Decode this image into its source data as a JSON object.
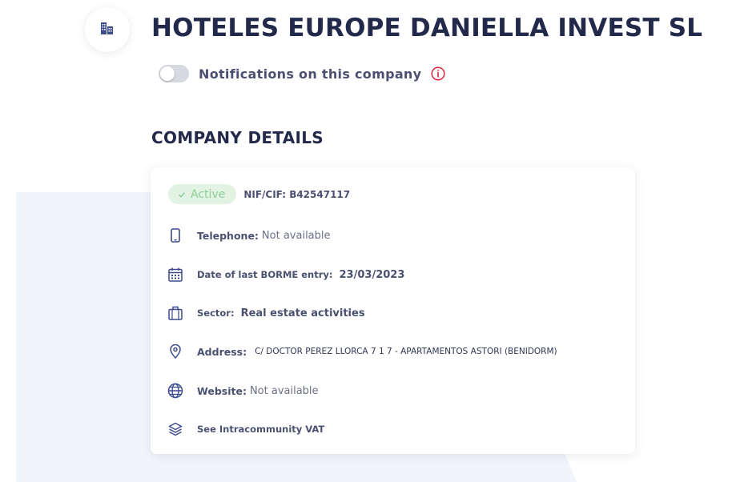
{
  "company": {
    "name": "HOTELES EUROPE DANIELLA INVEST SL",
    "logo_icon": "building-icon"
  },
  "notifications": {
    "label": "Notifications on this company",
    "enabled": false,
    "info_icon": "info-icon"
  },
  "details": {
    "section_title": "COMPANY DETAILS",
    "status": "Active",
    "nif": "NIF/CIF: B42547117",
    "rows": [
      {
        "icon": "phone-icon",
        "label": "Telephone:",
        "value": "Not available"
      },
      {
        "icon": "calendar-icon",
        "label": "Date of last BORME entry:",
        "value": "23/03/2023"
      },
      {
        "icon": "briefcase-icon",
        "label": "Sector:",
        "value": "Real estate activities"
      },
      {
        "icon": "location-pin-icon",
        "label": "Address:",
        "value": "C/ DOCTOR PEREZ LLORCA 7 1 7 - APARTAMENTOS ASTORI (BENIDORM)"
      },
      {
        "icon": "globe-icon",
        "label": "Website:",
        "value": "Not available"
      },
      {
        "icon": "layers-icon",
        "label": "See Intracommunity VAT"
      }
    ]
  },
  "colors": {
    "title": "#23294a",
    "accent": "#3d4b8c",
    "status_bg": "#e2f3e4",
    "status_text": "#8ccf96",
    "info": "#d7263d",
    "background_blob": "#f1f4fa"
  }
}
